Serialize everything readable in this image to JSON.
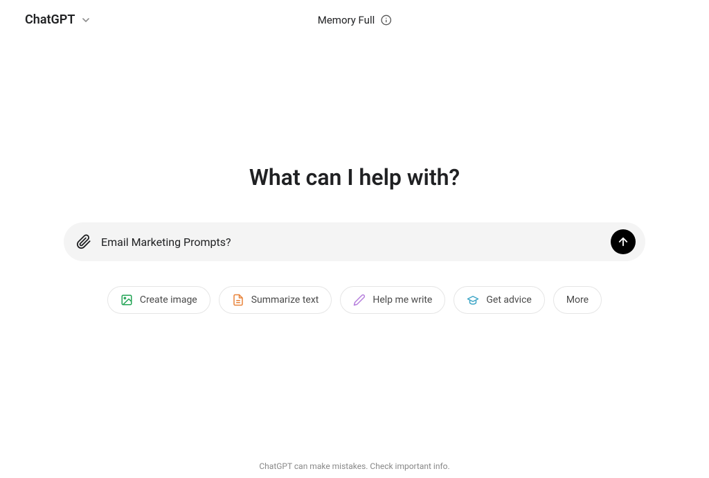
{
  "header": {
    "model_name": "ChatGPT",
    "memory_status": "Memory Full"
  },
  "main": {
    "heading": "What can I help with?",
    "input_value": "Email Marketing Prompts?"
  },
  "suggestions": {
    "create_image": "Create image",
    "summarize_text": "Summarize text",
    "help_me_write": "Help me write",
    "get_advice": "Get advice",
    "more": "More"
  },
  "footer": {
    "disclaimer": "ChatGPT can make mistakes. Check important info."
  },
  "icon_colors": {
    "create_image": "#23a455",
    "summarize_text": "#e8833a",
    "help_me_write": "#b57edc",
    "get_advice": "#3ea6c7"
  }
}
